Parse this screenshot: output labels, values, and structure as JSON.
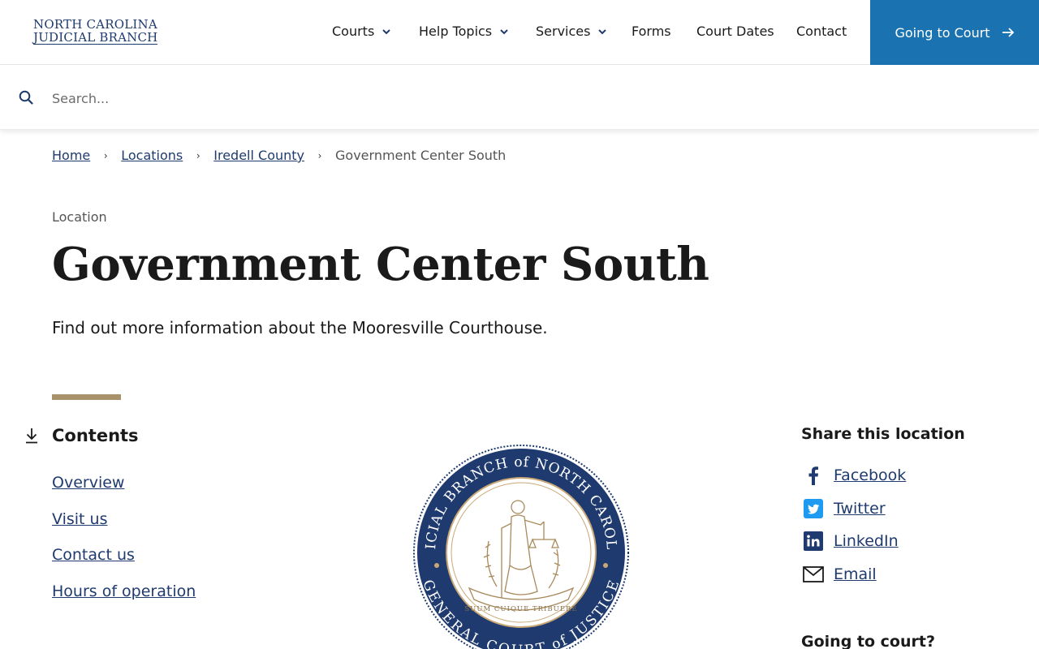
{
  "header": {
    "logo_line1": "NORTH CAROLINA",
    "logo_line2": "JUDICIAL BRANCH",
    "nav": [
      {
        "label": "Courts",
        "dropdown": true
      },
      {
        "label": "Help Topics",
        "dropdown": true
      },
      {
        "label": "Services",
        "dropdown": true
      },
      {
        "label": "Forms",
        "dropdown": false
      },
      {
        "label": "Court Dates",
        "dropdown": false
      },
      {
        "label": "Contact",
        "dropdown": false
      }
    ],
    "cta_label": "Going to Court"
  },
  "search": {
    "placeholder": "Search...",
    "value": ""
  },
  "breadcrumb": {
    "items": [
      "Home",
      "Locations",
      "Iredell County"
    ],
    "current": "Government Center South"
  },
  "page": {
    "eyebrow": "Location",
    "title": "Government Center South",
    "lede": "Find out more information about the Mooresville Courthouse."
  },
  "contents": {
    "title": "Contents",
    "items": [
      "Overview",
      "Visit us",
      "Contact us",
      "Hours of operation"
    ]
  },
  "seal": {
    "ring_top": "JUDICIAL BRANCH of NORTH CAROLINA",
    "ring_bottom": "GENERAL COURT of JUSTICE",
    "motto": "SUUM CUIQUE TRIBUERE"
  },
  "share": {
    "title": "Share this location",
    "items": [
      {
        "label": "Facebook",
        "icon": "facebook-icon"
      },
      {
        "label": "Twitter",
        "icon": "twitter-icon"
      },
      {
        "label": "LinkedIn",
        "icon": "linkedin-icon"
      },
      {
        "label": "Email",
        "icon": "email-icon"
      }
    ]
  },
  "going": {
    "title": "Going to court?"
  },
  "colors": {
    "navy": "#1f3a6e",
    "cta_blue": "#1a73b0",
    "accent_gold": "#a89269"
  }
}
